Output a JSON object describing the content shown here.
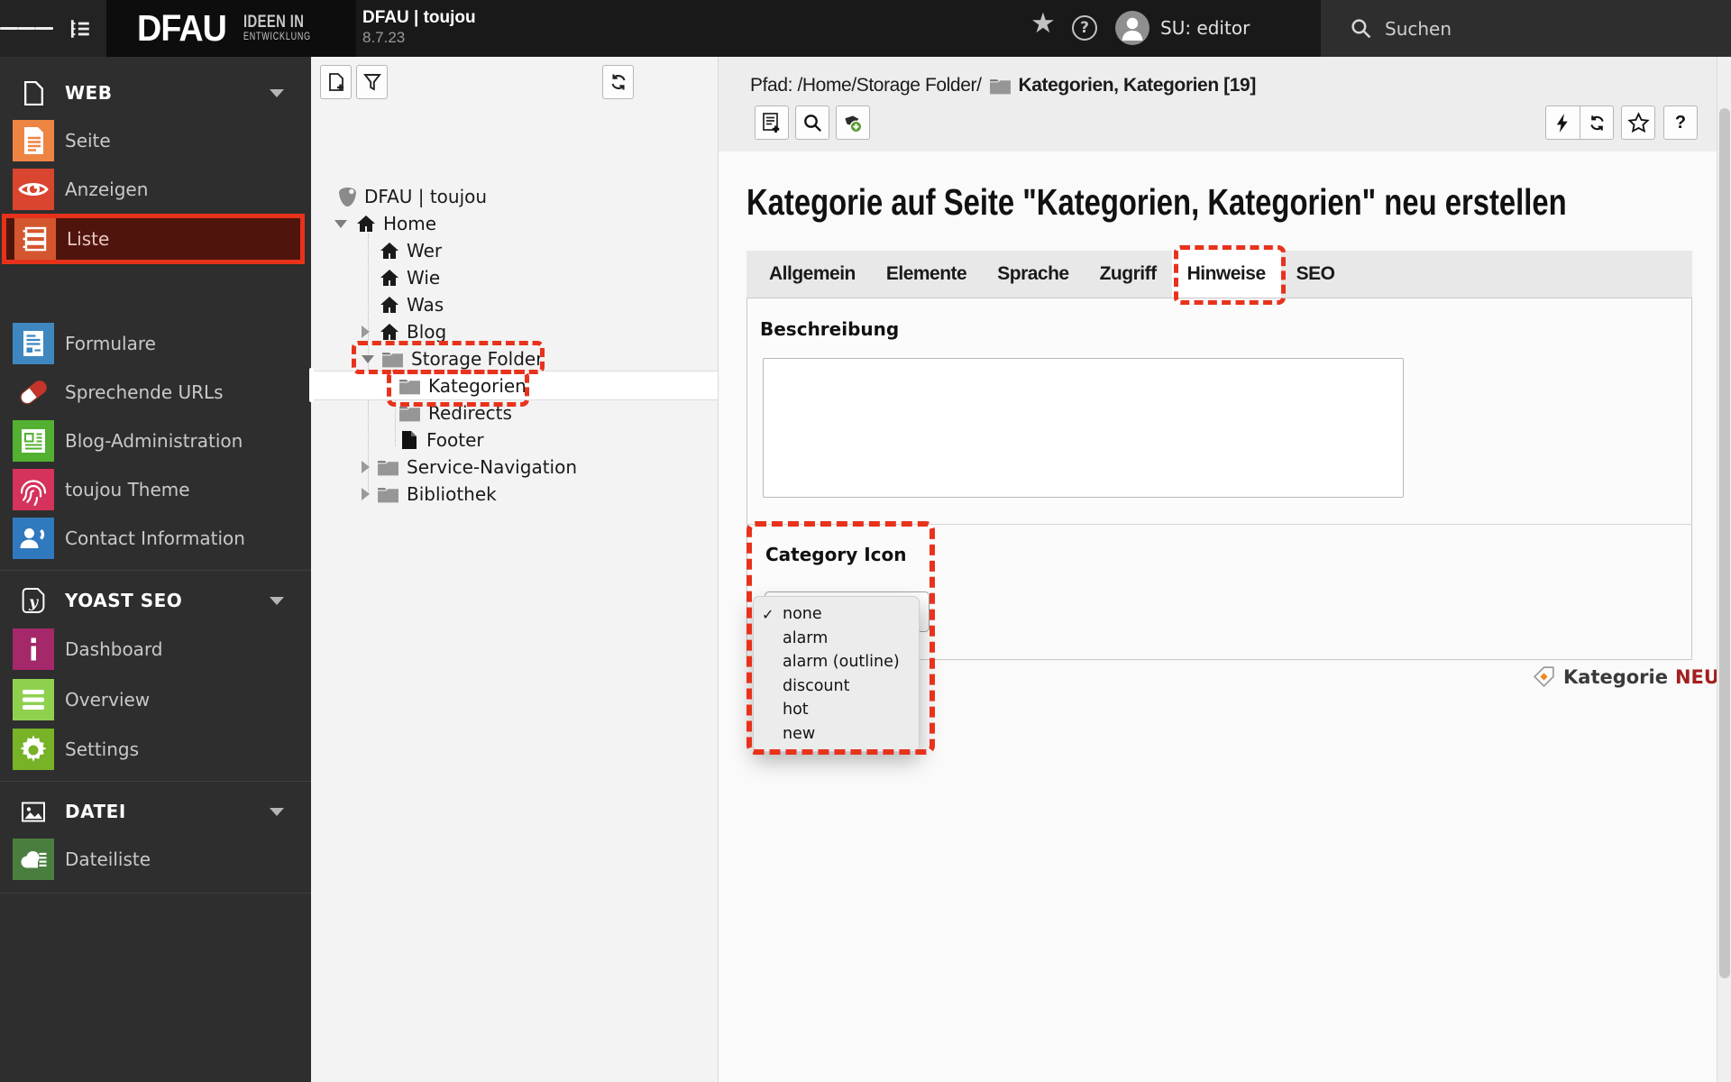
{
  "topbar": {
    "logo_text": "DFAU",
    "logo_claim_line1": "IDEEN IN",
    "logo_claim_line2": "ENTWICKLUNG",
    "site_title": "DFAU | toujou",
    "version": "8.7.23",
    "user": "SU: editor",
    "search_label": "Suchen",
    "icons": [
      "menu-icon",
      "pagetree-toggle-icon",
      "bookmark-star-icon",
      "help-icon",
      "avatar",
      "search-icon"
    ]
  },
  "sidebar": {
    "sections": [
      {
        "title": "WEB",
        "icon": "page-outline-icon",
        "items": [
          {
            "label": "Seite",
            "icon": "document-icon",
            "color": "#ee8442"
          },
          {
            "label": "Anzeigen",
            "icon": "eye-icon",
            "color": "#d9452f"
          },
          {
            "label": "Liste",
            "icon": "list-rows-icon",
            "color": "#d4562e",
            "active": true
          },
          {
            "label": "Formulare",
            "icon": "form-icon",
            "color": "#3e87c0"
          },
          {
            "label": "Sprechende URLs",
            "icon": "pill-icon",
            "color": ""
          },
          {
            "label": "Blog-Administration",
            "icon": "newspaper-icon",
            "color": "#53b031"
          },
          {
            "label": "toujou Theme",
            "icon": "fingerprint-icon",
            "color": "#d5325c"
          },
          {
            "label": "Contact Information",
            "icon": "contacts-icon",
            "color": "#3179be"
          }
        ]
      },
      {
        "title": "YOAST SEO",
        "icon": "yoast-icon",
        "items": [
          {
            "label": "Dashboard",
            "icon": "info-icon",
            "color": "#a4286a"
          },
          {
            "label": "Overview",
            "icon": "rows-icon",
            "color": "#8fd14f"
          },
          {
            "label": "Settings",
            "icon": "gear-icon",
            "color": "#77b227"
          }
        ]
      },
      {
        "title": "DATEI",
        "icon": "image-outline-icon",
        "items": [
          {
            "label": "Dateiliste",
            "icon": "filelist-icon",
            "color": "#4a7e3e"
          }
        ]
      }
    ]
  },
  "page_tree": {
    "items": [
      {
        "label": "DFAU | toujou",
        "icon": "typo3-logo-icon",
        "level": 0
      },
      {
        "label": "Home",
        "icon": "home-icon",
        "level": 1,
        "expander": "open"
      },
      {
        "label": "Wer",
        "icon": "home-icon",
        "level": 2
      },
      {
        "label": "Wie",
        "icon": "home-icon",
        "level": 2
      },
      {
        "label": "Was",
        "icon": "home-icon",
        "level": 2
      },
      {
        "label": "Blog",
        "icon": "home-icon",
        "level": 2,
        "expander": "closed"
      },
      {
        "label": "Storage Folder",
        "icon": "folder-icon",
        "level": 2,
        "expander": "open",
        "annotated": true
      },
      {
        "label": "Kategorien",
        "icon": "folder-icon",
        "level": 3,
        "selected": true,
        "annotated": true
      },
      {
        "label": "Redirects",
        "icon": "folder-icon",
        "level": 3
      },
      {
        "label": "Footer",
        "icon": "document-black-icon",
        "level": 3
      },
      {
        "label": "Service-Navigation",
        "icon": "folder-icon",
        "level": 2,
        "expander": "closed"
      },
      {
        "label": "Bibliothek",
        "icon": "folder-icon",
        "level": 2,
        "expander": "closed"
      }
    ]
  },
  "doc_header": {
    "path_prefix": "Pfad: /Home/Storage Folder/",
    "record_title": "Kategorien, Kategorien [19]",
    "toolbar_icons": [
      "new-page-icon",
      "filter-icon",
      "refresh-icon",
      "new-record-icon",
      "search-icon",
      "new-category-icon",
      "bolt-icon",
      "reload-icon",
      "star-outline-icon",
      "help-icon"
    ],
    "help_label": "?"
  },
  "main": {
    "title": "Kategorie auf Seite \"Kategorien, Kategorien\" neu erstellen",
    "tabs": [
      {
        "label": "Allgemein"
      },
      {
        "label": "Elemente"
      },
      {
        "label": "Sprache"
      },
      {
        "label": "Zugriff"
      },
      {
        "label": "Hinweise",
        "active": true,
        "annotated": true
      },
      {
        "label": "SEO"
      }
    ],
    "form": {
      "description_label": "Beschreibung",
      "description_value": "",
      "category_icon_label": "Category Icon",
      "category_icon_selected": "none",
      "category_icon_options": [
        "none",
        "alarm",
        "alarm (outline)",
        "discount",
        "hot",
        "new"
      ]
    },
    "footer_badge": {
      "icon": "tag-icon",
      "label": "Kategorie",
      "status": "NEU",
      "status_color": "#a31f1f"
    }
  },
  "annotations": {
    "highlight_color": "#e8321c",
    "solid_box_color": "#e6321b",
    "targets": [
      "Liste module",
      "Storage Folder node",
      "Kategorien node",
      "Hinweise tab",
      "Category Icon field"
    ]
  }
}
